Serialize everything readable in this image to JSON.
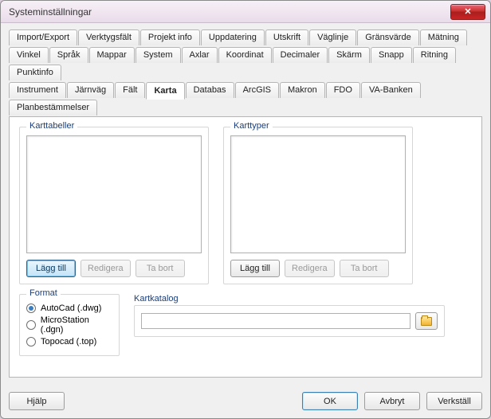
{
  "window": {
    "title": "Systeminställningar"
  },
  "tabs": {
    "row1": [
      "Import/Export",
      "Verktygsfält",
      "Projekt info",
      "Uppdatering",
      "Utskrift",
      "Väglinje",
      "Gränsvärde",
      "Mätning"
    ],
    "row2": [
      "Vinkel",
      "Språk",
      "Mappar",
      "System",
      "Axlar",
      "Koordinat",
      "Decimaler",
      "Skärm",
      "Snapp",
      "Ritning",
      "Punktinfo"
    ],
    "row3": [
      "Instrument",
      "Järnväg",
      "Fält",
      "Karta",
      "Databas",
      "ArcGIS",
      "Makron",
      "FDO",
      "VA-Banken",
      "Planbestämmelser"
    ],
    "active": "Karta"
  },
  "karta": {
    "karttabeller": {
      "label": "Karttabeller",
      "add": "Lägg till",
      "edit": "Redigera",
      "remove": "Ta bort"
    },
    "karttyper": {
      "label": "Karttyper",
      "add": "Lägg till",
      "edit": "Redigera",
      "remove": "Ta bort"
    },
    "format": {
      "label": "Format",
      "options": [
        "AutoCad (.dwg)",
        "MicroStation (.dgn)",
        "Topocad (.top)"
      ],
      "selected": 0
    },
    "kartkatalog": {
      "label": "Kartkatalog",
      "value": ""
    }
  },
  "footer": {
    "help": "Hjälp",
    "ok": "OK",
    "cancel": "Avbryt",
    "apply": "Verkställ"
  }
}
